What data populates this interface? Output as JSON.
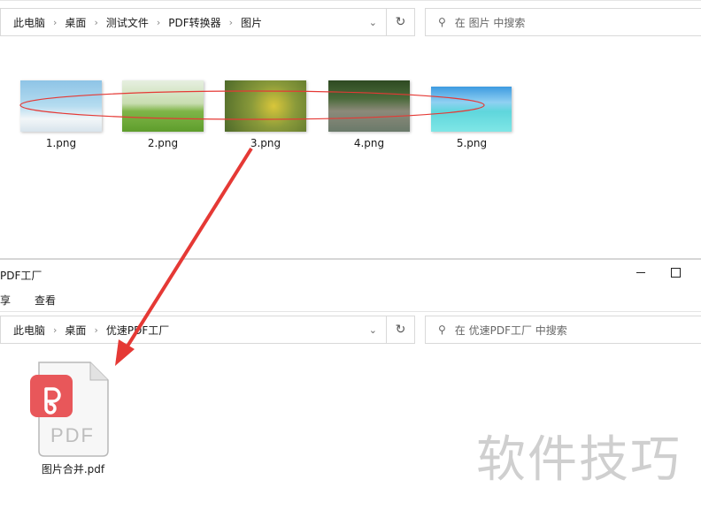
{
  "top_window": {
    "breadcrumb": [
      "此电脑",
      "桌面",
      "测试文件",
      "PDF转换器",
      "图片"
    ],
    "search_placeholder": "在 图片 中搜索",
    "files": [
      {
        "name": "1.png"
      },
      {
        "name": "2.png"
      },
      {
        "name": "3.png"
      },
      {
        "name": "4.png"
      },
      {
        "name": "5.png"
      }
    ]
  },
  "bottom_window": {
    "title": "PDF工厂",
    "menu": [
      "享",
      "查看"
    ],
    "breadcrumb": [
      "此电脑",
      "桌面",
      "优速PDF工厂"
    ],
    "search_placeholder": "在 优速PDF工厂 中搜索",
    "file": {
      "name": "图片合并.pdf",
      "icon_text": "PDF"
    }
  },
  "watermark": "软件技巧",
  "colors": {
    "annotation_red": "#e53935",
    "pdf_badge": "#e8575a"
  }
}
